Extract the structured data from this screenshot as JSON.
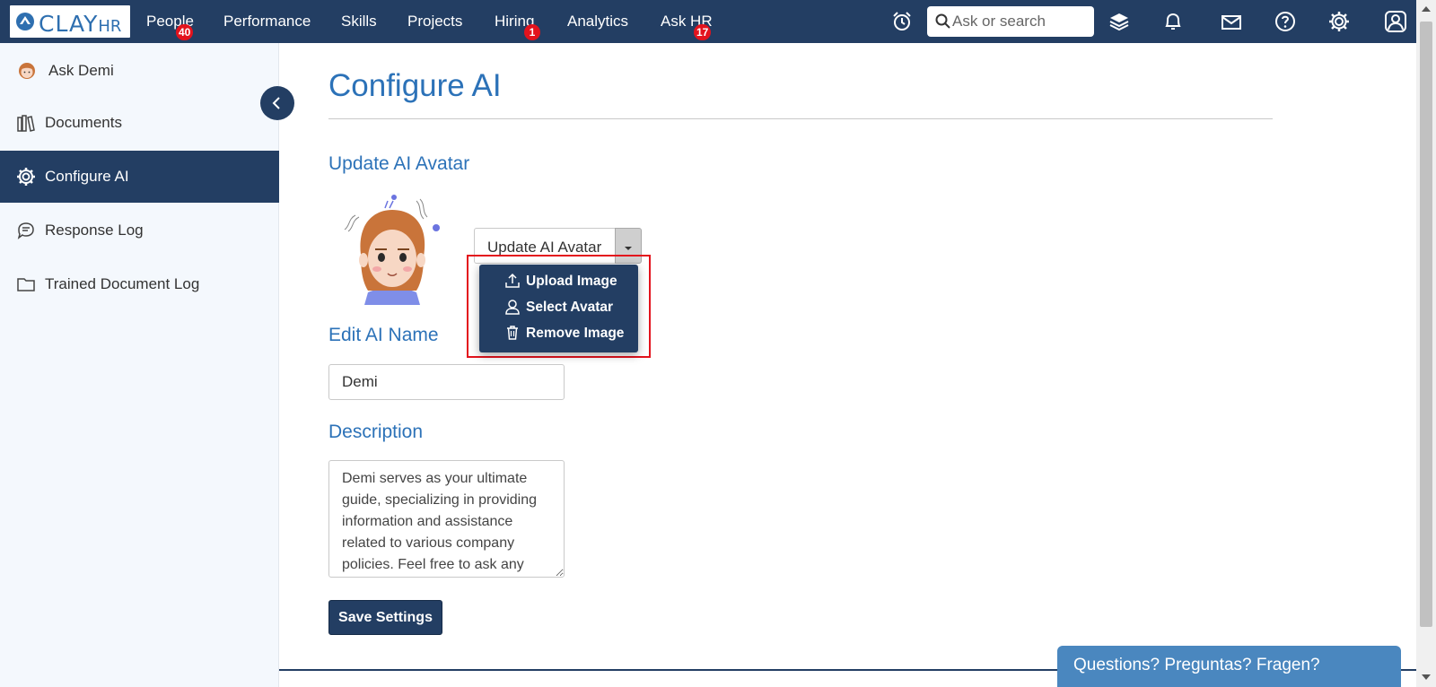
{
  "app": {
    "logo_text": "CLAY",
    "logo_suffix": "HR"
  },
  "nav": {
    "items": [
      {
        "label": "People",
        "badge": "40"
      },
      {
        "label": "Performance"
      },
      {
        "label": "Skills"
      },
      {
        "label": "Projects"
      },
      {
        "label": "Hiring",
        "badge": "1"
      },
      {
        "label": "Analytics"
      },
      {
        "label": "Ask HR",
        "badge": "17"
      }
    ],
    "search_placeholder": "Ask or search",
    "icons": [
      "alarm-clock-icon",
      "layers-icon",
      "bell-icon",
      "mail-icon",
      "help-icon",
      "gear-icon",
      "user-icon"
    ]
  },
  "sidebar": {
    "items": [
      {
        "label": "Ask Demi",
        "icon": "ai-avatar-icon"
      },
      {
        "label": "Documents",
        "icon": "books-icon"
      },
      {
        "label": "Configure AI",
        "icon": "gear-icon",
        "active": true
      },
      {
        "label": "Response Log",
        "icon": "chat-icon"
      },
      {
        "label": "Trained Document Log",
        "icon": "folder-icon"
      }
    ]
  },
  "main": {
    "title": "Configure AI",
    "avatar_section": {
      "heading": "Update AI Avatar",
      "button_label": "Update AI Avatar",
      "menu": [
        {
          "label": "Upload Image",
          "icon": "upload-icon"
        },
        {
          "label": "Select Avatar",
          "icon": "person-icon"
        },
        {
          "label": "Remove Image",
          "icon": "trash-icon"
        }
      ]
    },
    "name_section": {
      "heading": "Edit AI Name",
      "value": "Demi"
    },
    "description_section": {
      "heading": "Description",
      "value": "Demi serves as your ultimate guide, specializing in providing information and assistance related to various company policies. Feel free to ask any"
    },
    "save_label": "Save Settings"
  },
  "help_tab": {
    "label": "Questions? Preguntas? Fragen?"
  },
  "colors": {
    "navy": "#233e63",
    "title_blue": "#2c72b8",
    "badge_red": "#e3131d",
    "sidebar_bg": "#f4f8fd",
    "help_tab_blue": "#4a87bf"
  }
}
